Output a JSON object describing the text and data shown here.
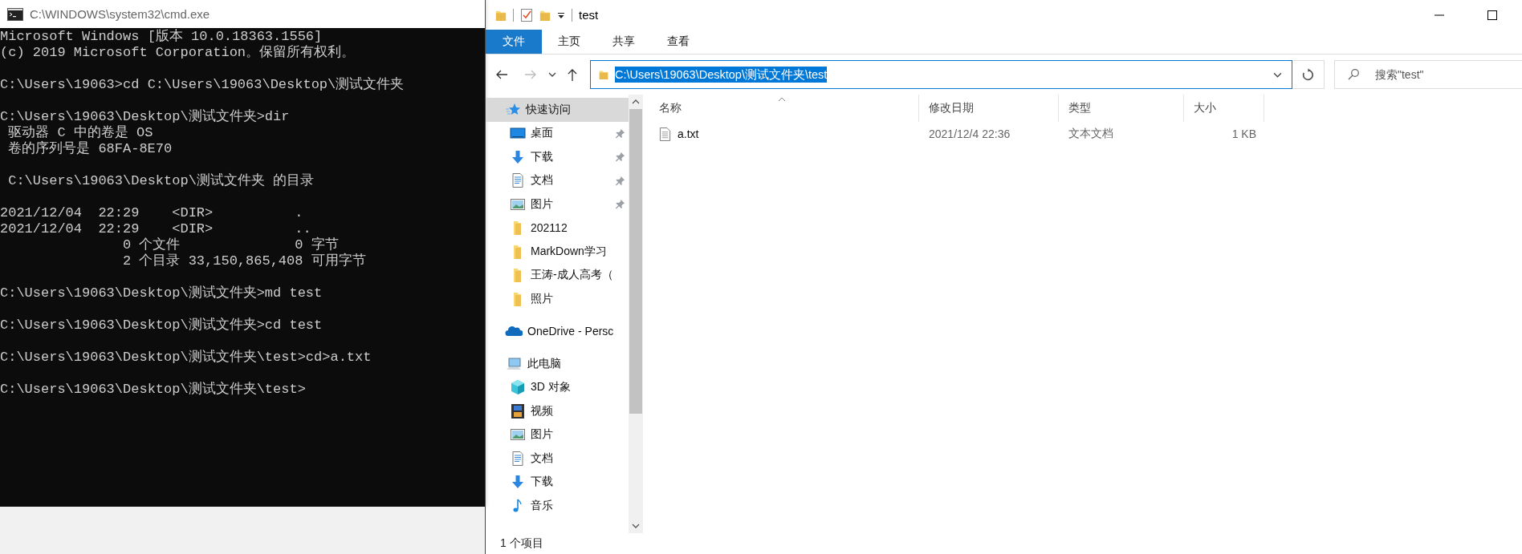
{
  "cmd": {
    "title": "C:\\WINDOWS\\system32\\cmd.exe",
    "blocks": [
      [
        "Microsoft Windows [版本 10.0.18363.1556]",
        "(c) 2019 Microsoft Corporation。保留所有权利。"
      ],
      [
        "C:\\Users\\19063>cd C:\\Users\\19063\\Desktop\\测试文件夹"
      ],
      [
        "C:\\Users\\19063\\Desktop\\测试文件夹>dir",
        " 驱动器 C 中的卷是 OS",
        " 卷的序列号是 68FA-8E70"
      ],
      [
        " C:\\Users\\19063\\Desktop\\测试文件夹 的目录"
      ],
      [
        "2021/12/04  22:29    <DIR>          .",
        "2021/12/04  22:29    <DIR>          ..",
        "               0 个文件              0 字节",
        "               2 个目录 33,150,865,408 可用字节"
      ],
      [
        "C:\\Users\\19063\\Desktop\\测试文件夹>md test"
      ],
      [
        "C:\\Users\\19063\\Desktop\\测试文件夹>cd test"
      ],
      [
        "C:\\Users\\19063\\Desktop\\测试文件夹\\test>cd>a.txt"
      ],
      [
        "C:\\Users\\19063\\Desktop\\测试文件夹\\test>"
      ]
    ]
  },
  "explorer": {
    "title": "test",
    "ribbon_tabs": [
      {
        "label": "文件",
        "kind": "file-menu"
      },
      {
        "label": "主页",
        "kind": "tab"
      },
      {
        "label": "共享",
        "kind": "tab"
      },
      {
        "label": "查看",
        "kind": "tab"
      }
    ],
    "nav": {
      "forward_disabled": true
    },
    "address": "C:\\Users\\19063\\Desktop\\测试文件夹\\test",
    "search": {
      "placeholder": "搜索\"test\""
    },
    "sidebar": {
      "items": [
        {
          "label": "快速访问",
          "kind": "star",
          "selected": true,
          "children": [
            {
              "label": "桌面",
              "kind": "desktop",
              "pinned": true,
              "selected": false
            },
            {
              "label": "下载",
              "kind": "download",
              "pinned": true,
              "selected": false
            },
            {
              "label": "文档",
              "kind": "document",
              "pinned": true,
              "selected": false
            },
            {
              "label": "图片",
              "kind": "picture",
              "pinned": true,
              "selected": false
            },
            {
              "label": "202112",
              "kind": "folder",
              "pinned": false,
              "selected": false
            },
            {
              "label": "MarkDown学习",
              "kind": "folder",
              "pinned": false,
              "selected": false
            },
            {
              "label": "王涛-成人高考（",
              "kind": "folder",
              "pinned": false,
              "selected": false
            },
            {
              "label": "照片",
              "kind": "folder",
              "pinned": false,
              "selected": false
            }
          ]
        },
        {
          "label": "OneDrive - Persc",
          "kind": "cloud",
          "selected": false
        },
        {
          "label": "此电脑",
          "kind": "pc",
          "selected": false,
          "children": [
            {
              "label": "3D 对象",
              "kind": "cube",
              "selected": false
            },
            {
              "label": "视频",
              "kind": "video",
              "selected": false
            },
            {
              "label": "图片",
              "kind": "picture",
              "selected": false
            },
            {
              "label": "文档",
              "kind": "document",
              "selected": false
            },
            {
              "label": "下载",
              "kind": "download",
              "selected": false
            },
            {
              "label": "音乐",
              "kind": "music",
              "selected": false
            }
          ]
        }
      ]
    },
    "columns": [
      "名称",
      "修改日期",
      "类型",
      "大小"
    ],
    "files": [
      {
        "name": "a.txt",
        "modified": "2021/12/4 22:36",
        "type": "文本文档",
        "size": "1 KB"
      }
    ],
    "status_bar": "1 个项目"
  }
}
